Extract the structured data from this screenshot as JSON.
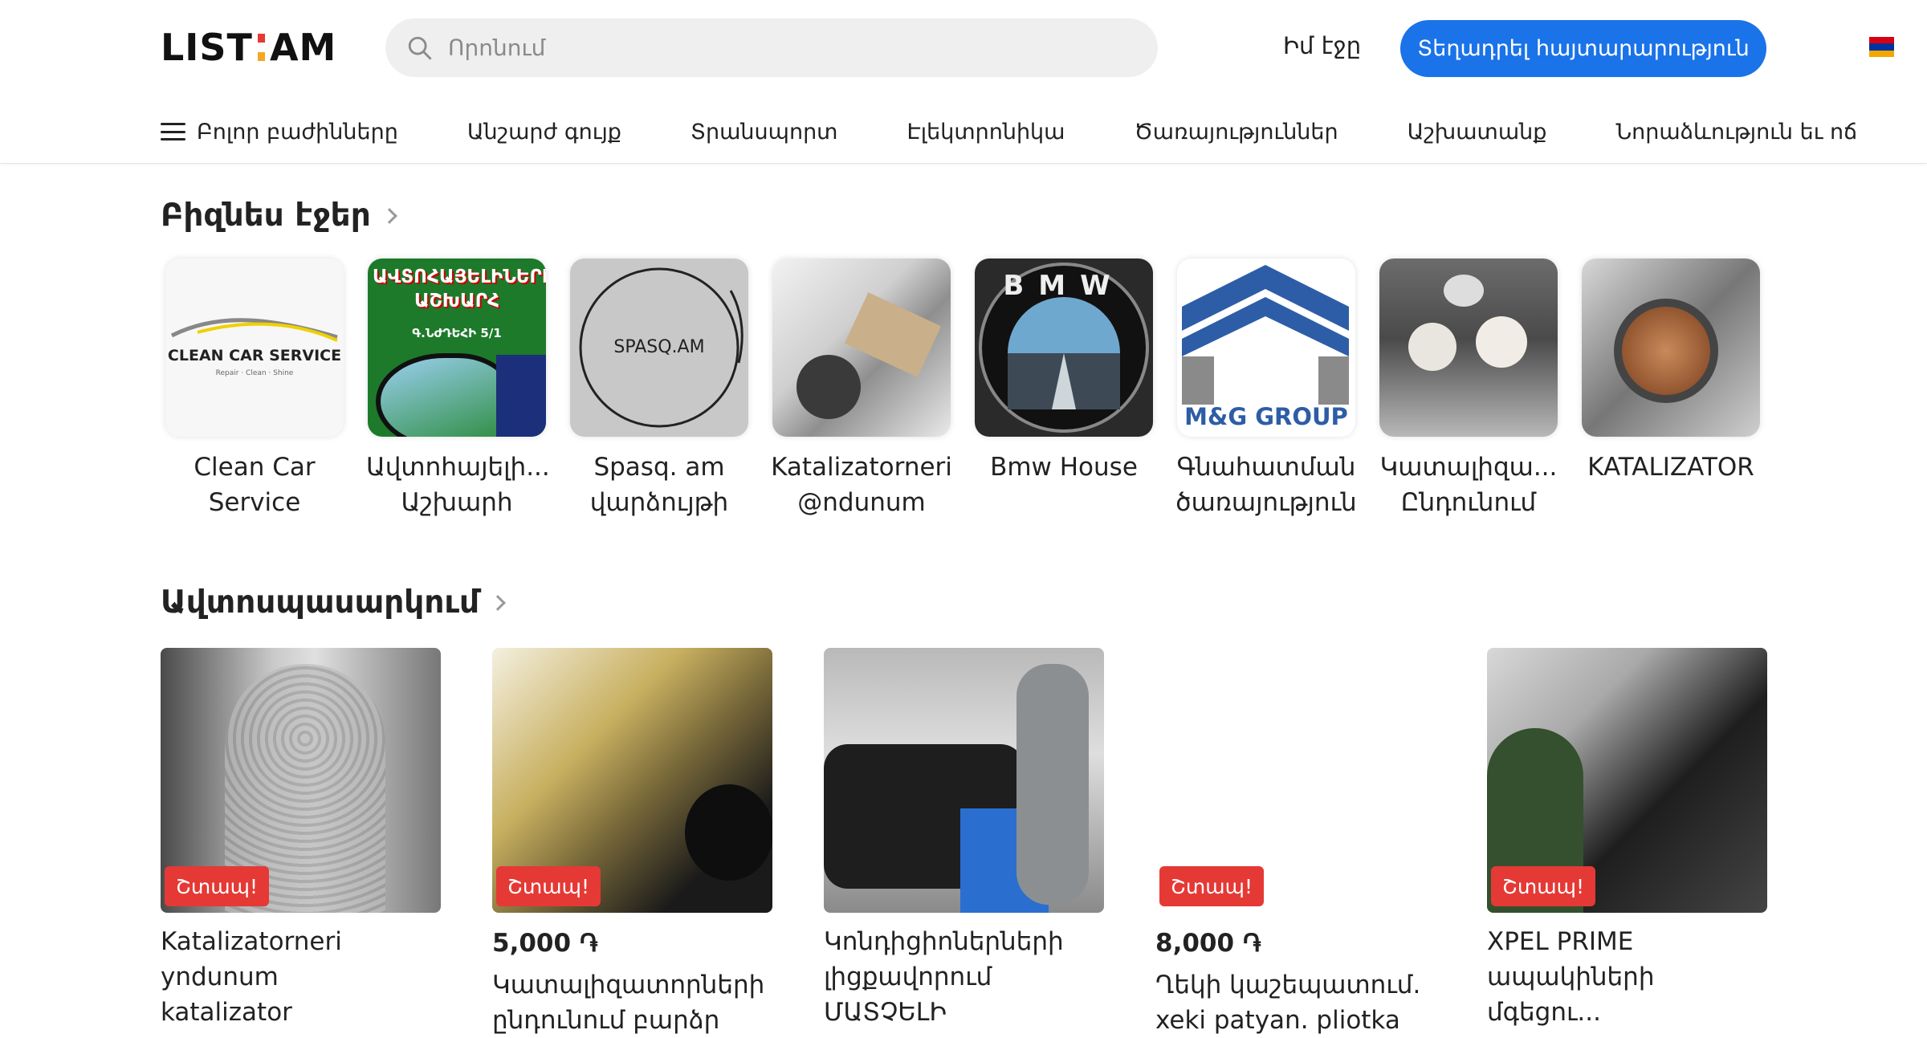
{
  "header": {
    "logo_left": "LIST",
    "logo_right": "AM",
    "search_placeholder": "Որոնում",
    "my_page": "Իմ էջը",
    "post_button": "Տեղադրել հայտարարություն",
    "flag_colors": [
      "#d90012",
      "#0033a0",
      "#f2a800"
    ]
  },
  "nav": {
    "items": [
      "Բոլոր բաժինները",
      "Անշարժ գույք",
      "Տրանսպորտ",
      "Էլեկտրոնիկա",
      "Ծառայություններ",
      "Աշխատանք",
      "Նորաձևություն եւ ոճ"
    ]
  },
  "business": {
    "title": "Բիզնես էջեր",
    "pages": [
      {
        "line1": "Clean Car",
        "line2": "Service",
        "logo_text": "CLEAN CAR SERVICE",
        "logo_sub": "Repair · Clean · Shine"
      },
      {
        "line1": "Ավտոհայելի...",
        "line2": "Աշխարհ",
        "logo_text": "ԱՎՏՈՀԱՅԵԼԻՆԵՐԻ ԱՇԽԱՐՀ",
        "logo_sub": "Գ.ՆԺԴԵՀԻ 5/1"
      },
      {
        "line1": "Spasq. am",
        "line2": "վարձույթի",
        "logo_text": "SPASQ.AM"
      },
      {
        "line1": "Katalizatorneri",
        "line2": "@ndunum"
      },
      {
        "line1": "Bmw House",
        "line2": "",
        "logo_text": "BMW"
      },
      {
        "line1": "Գնահատման",
        "line2": "ծառայություն",
        "logo_text": "M&G GROUP"
      },
      {
        "line1": "Կատալիզա...",
        "line2": "Ընդունում"
      },
      {
        "line1": "KATALIZATOR",
        "line2": ""
      }
    ]
  },
  "autoservice": {
    "title": "Ավտոսպասարկում",
    "badge": "Շտապ!",
    "ads": [
      {
        "price": "",
        "line1": "Katalizatorneri yndunum",
        "line2": "katalizator"
      },
      {
        "price": "5,000 ֏",
        "line1": "Կատալիզատորների",
        "line2": "ընդունում բարձր"
      },
      {
        "price": "",
        "line1": "Կոնդիցիոներների",
        "line2": "լիցքավորում ՄԱՏՉԵԼԻ"
      },
      {
        "price": "8,000 ֏",
        "line1": "Ղեկի կաշեպատում.",
        "line2": "xeki patyan. pliotka"
      },
      {
        "price": "",
        "line1": "XPEL PRIME",
        "line2": "ապակիների մգեցու..."
      }
    ]
  }
}
